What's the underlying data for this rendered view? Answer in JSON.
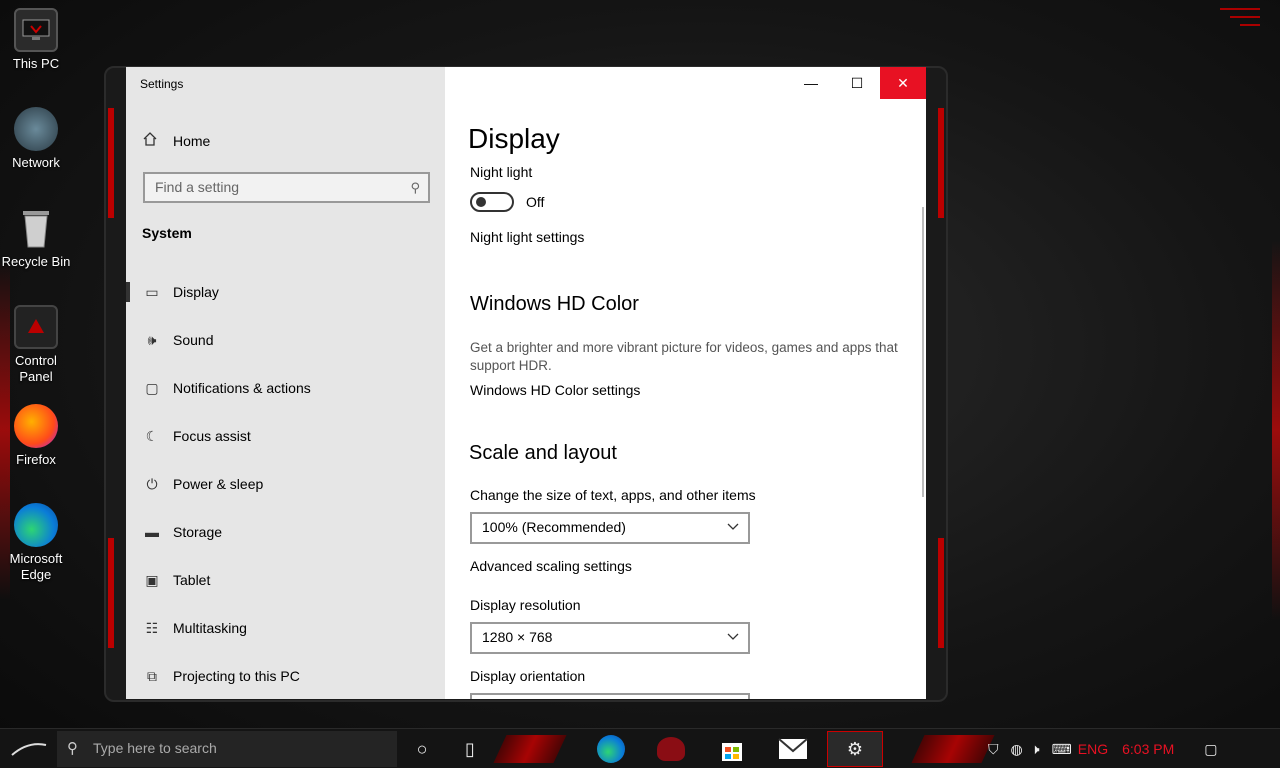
{
  "desktop": {
    "icons": [
      {
        "label": "This PC",
        "icon": "computer-icon"
      },
      {
        "label": "Network",
        "icon": "network-globe-icon"
      },
      {
        "label": "Recycle Bin",
        "icon": "recycle-bin-icon"
      },
      {
        "label": "Control Panel",
        "icon": "control-panel-icon"
      },
      {
        "label": "Firefox",
        "icon": "firefox-icon"
      },
      {
        "label": "Microsoft Edge",
        "icon": "edge-icon"
      }
    ]
  },
  "window": {
    "title": "Settings",
    "controls": {
      "minimize": "—",
      "maximize": "☐",
      "close": "✕"
    }
  },
  "sidebar": {
    "home_label": "Home",
    "search_placeholder": "Find a setting",
    "group_label": "System",
    "items": [
      {
        "label": "Display",
        "icon": "monitor-icon",
        "glyph": "▭"
      },
      {
        "label": "Sound",
        "icon": "speaker-icon",
        "glyph": "🕪"
      },
      {
        "label": "Notifications & actions",
        "icon": "notification-icon",
        "glyph": "▢"
      },
      {
        "label": "Focus assist",
        "icon": "moon-icon",
        "glyph": "☾"
      },
      {
        "label": "Power & sleep",
        "icon": "power-icon",
        "glyph": "⏻"
      },
      {
        "label": "Storage",
        "icon": "storage-icon",
        "glyph": "▬"
      },
      {
        "label": "Tablet",
        "icon": "tablet-icon",
        "glyph": "▣"
      },
      {
        "label": "Multitasking",
        "icon": "multitasking-icon",
        "glyph": "☷"
      },
      {
        "label": "Projecting to this PC",
        "icon": "projecting-icon",
        "glyph": "⧉"
      }
    ]
  },
  "main": {
    "page_title": "Display",
    "night_light": {
      "label": "Night light",
      "state": "Off",
      "settings_link": "Night light settings"
    },
    "hd_color": {
      "heading": "Windows HD Color",
      "description": "Get a brighter and more vibrant picture for videos, games and apps that support HDR.",
      "settings_link": "Windows HD Color settings"
    },
    "scale_layout": {
      "heading": "Scale and layout",
      "scale_label": "Change the size of text, apps, and other items",
      "scale_value": "100% (Recommended)",
      "advanced_link": "Advanced scaling settings",
      "resolution_label": "Display resolution",
      "resolution_value": "1280 × 768",
      "orientation_label": "Display orientation"
    }
  },
  "taskbar": {
    "search_placeholder": "Type here to search",
    "language": "ENG",
    "time": "6:03 PM"
  },
  "colors": {
    "accent_red": "#e81123",
    "sidebar_bg": "#e6e6e6",
    "taskbar_bg": "#141414"
  }
}
